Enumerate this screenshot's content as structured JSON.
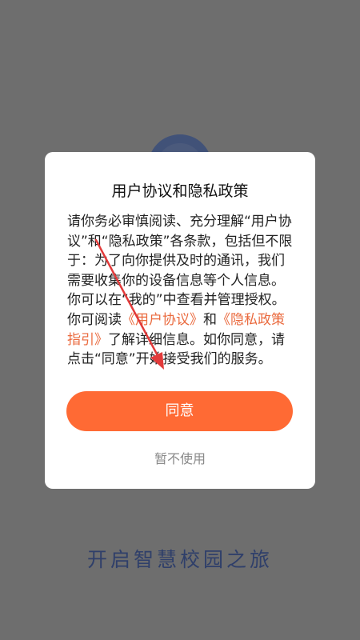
{
  "background": {
    "slogan": "开启智慧校园之旅"
  },
  "dialog": {
    "title": "用户协议和隐私政策",
    "body_part1": "请你务必审慎阅读、充分理解“用户协议”和“隐私政策”各条款，包括但不限于：为了向你提供及时的通讯，我们需要收集你的设备信息等个人信息。你可以在“我的”中查看并管理授权。你可阅读",
    "link_user_agreement": "《用户协议》",
    "body_and": "和",
    "link_privacy_guide": "《隐私政策指引》",
    "body_part2": "了解详细信息。如你同意，请点击“同意”开始接受我们的服务。",
    "agree_label": "同意",
    "decline_label": "暂不使用"
  },
  "colors": {
    "overlay": "#6e6e6e",
    "accent": "#ff6a34",
    "link": "#ea6a3e",
    "annotation_arrow": "#e23a3a"
  }
}
